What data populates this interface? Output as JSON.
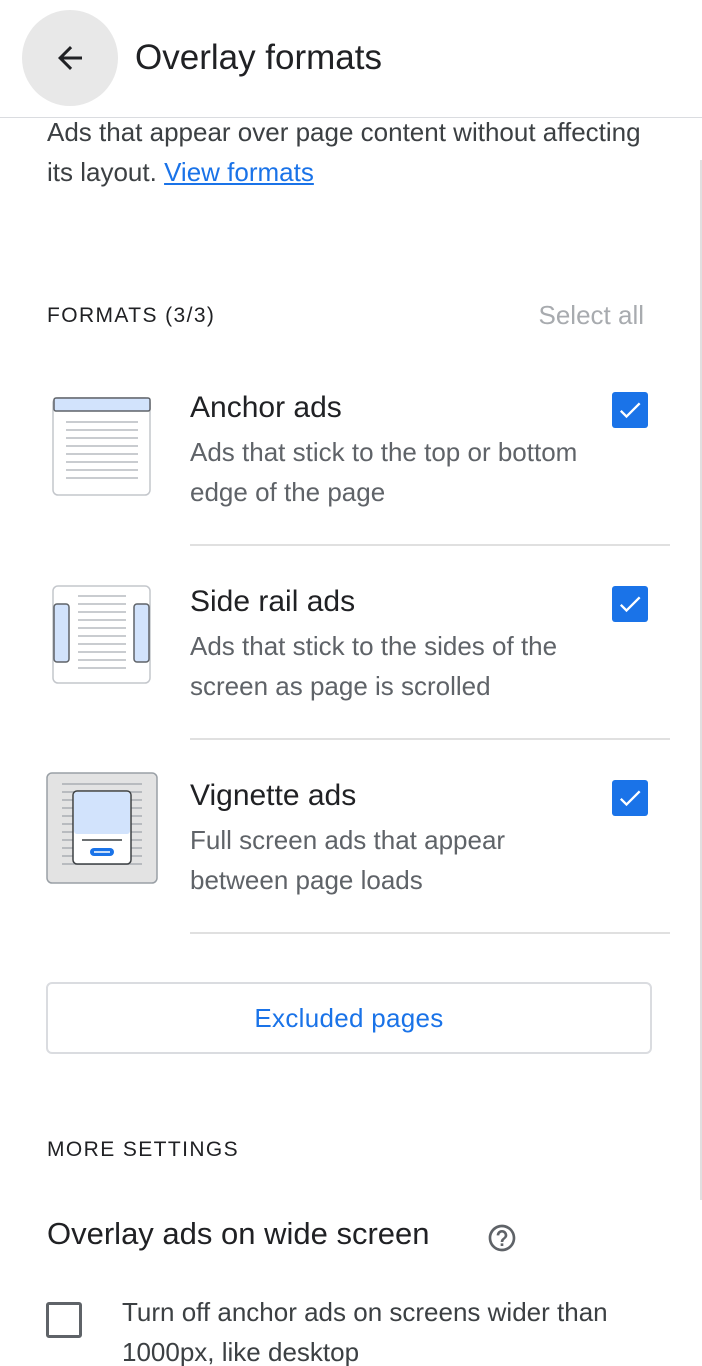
{
  "header": {
    "title": "Overlay formats",
    "back_icon": "arrow-left-icon"
  },
  "intro": {
    "text": "Ads that appear over page content without affecting its layout.",
    "link": "View formats"
  },
  "formats": {
    "label": "FORMATS (3/3)",
    "select_all": "Select all",
    "items": [
      {
        "title": "Anchor ads",
        "description": "Ads that stick to the top or bottom edge of the page",
        "checked": true,
        "icon": "anchor-ads-thumbnail"
      },
      {
        "title": "Side rail ads",
        "description": "Ads that stick to the sides of the screen as page is scrolled",
        "checked": true,
        "icon": "side-rail-ads-thumbnail"
      },
      {
        "title": "Vignette ads",
        "description": "Full screen ads that appear between page loads",
        "checked": true,
        "icon": "vignette-ads-thumbnail"
      }
    ]
  },
  "excluded_pages": {
    "label": "Excluded pages"
  },
  "more_settings": {
    "label": "MORE SETTINGS",
    "overlay_title": "Overlay ads on wide screen",
    "help_icon": "question-circle-icon",
    "wide_option": {
      "label": "Turn off anchor ads on screens wider than 1000px, like desktop",
      "checked": false
    }
  },
  "colors": {
    "accent": "#1a73e8",
    "thumb_fill": "#d2e3fc",
    "divider": "#e0e0e0"
  }
}
